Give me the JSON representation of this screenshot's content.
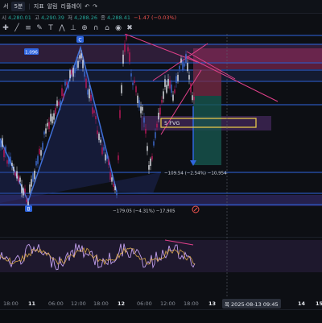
{
  "toolbar": {
    "items": [
      "서",
      "5분",
      "지표",
      "알림",
      "리플레이"
    ],
    "ohlc_label_o": "시",
    "ohlc_o": "4,280.01",
    "ohlc_label_h": "고",
    "ohlc_h": "4,290.39",
    "ohlc_label_l": "저",
    "ohlc_l": "4,288.26",
    "ohlc_label_c": "종",
    "ohlc_c": "4,288.41",
    "change": "−1.47 (−0.03%)"
  },
  "drawing_tools": [
    "crosshair",
    "trend-line",
    "fib",
    "pen",
    "text",
    "pattern",
    "ruler",
    "zoom",
    "magnet",
    "lock",
    "eye",
    "trash"
  ],
  "chart": {
    "label_c": "C",
    "label_b": "B",
    "price_tag": "1.096",
    "fvg_label": "5 FVG",
    "measure_up": "−109.54 (−2.54%) −10,954",
    "measure_down": "−179.05 (−4.31%) −17,905"
  },
  "xaxis": {
    "ticks": [
      "18:00",
      "11",
      "06:00",
      "12:00",
      "18:00",
      "12",
      "06:00",
      "12:00",
      "18:00",
      "13",
      "14",
      "15"
    ],
    "crosshair_label": "목 2025-08-13",
    "crosshair_time": "09:45"
  },
  "colors": {
    "bull": "#26a69a",
    "bear": "#ef5350",
    "wave": "#3f6fd8",
    "line_pink": "#e0408a",
    "fvg": "#e5c649"
  }
}
